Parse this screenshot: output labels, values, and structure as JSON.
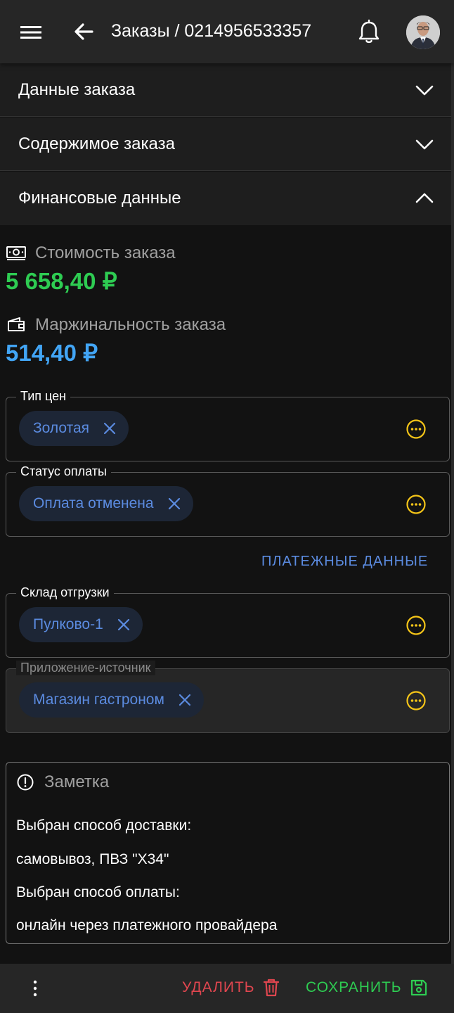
{
  "header": {
    "title": "Заказы / 0214956533357",
    "menu_icon": "menu-icon",
    "back_icon": "arrow-left-icon",
    "notification_icon": "bell-icon"
  },
  "accordions": [
    {
      "label": "Данные заказа",
      "expanded": false
    },
    {
      "label": "Содержимое заказа",
      "expanded": false
    },
    {
      "label": "Финансовые данные",
      "expanded": true
    }
  ],
  "finance": {
    "cost_label": "Стоимость заказа",
    "cost_value": "5 658,40 ₽",
    "cost_color": "#2ecc52",
    "margin_label": "Маржинальность заказа",
    "margin_value": "514,40 ₽",
    "margin_color": "#42a5f5"
  },
  "fields": {
    "price_type": {
      "label": "Тип цен",
      "value": "Золотая"
    },
    "payment_status": {
      "label": "Статус оплаты",
      "value": "Оплата отменена"
    },
    "warehouse": {
      "label": "Склад отгрузки",
      "value": "Пулково-1"
    },
    "source_app": {
      "label": "Приложение-источник",
      "value": "Магазин гастроном",
      "disabled": true
    }
  },
  "payment_link": "ПЛАТЕЖНЫЕ ДАННЫЕ",
  "note": {
    "title": "Заметка",
    "lines": [
      "Выбран способ доставки:",
      "самовывоз, ПВЗ \"X34\"",
      "Выбран способ оплаты:",
      "онлайн через платежного провайдера"
    ]
  },
  "bottom": {
    "delete_label": "УДАЛИТЬ",
    "delete_color": "#e0464f",
    "save_label": "СОХРАНИТЬ",
    "save_color": "#2ecc52"
  },
  "colors": {
    "accent_blue": "#5b8be0",
    "more_icon": "#f5c518"
  }
}
